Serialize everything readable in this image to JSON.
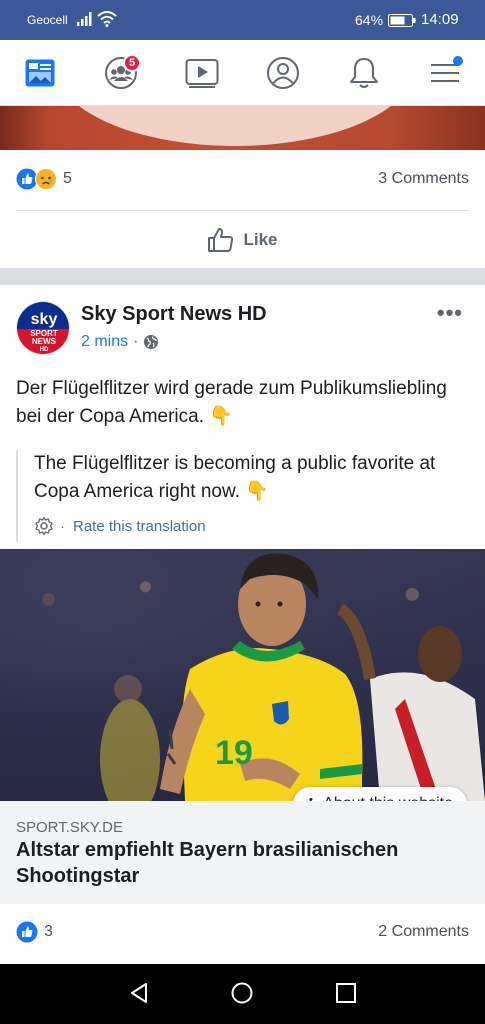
{
  "status_bar": {
    "carrier": "Geocell",
    "battery_percent": "64%",
    "time": "14:09"
  },
  "nav_bar": {
    "friends_badge": "5",
    "icons": [
      "news-feed-icon",
      "friends-icon",
      "watch-icon",
      "profile-icon",
      "notifications-icon",
      "menu-icon"
    ]
  },
  "previous_post": {
    "reaction_count": "5",
    "comments": "3 Comments",
    "like_label": "Like"
  },
  "post": {
    "page_name": "Sky Sport News HD",
    "avatar_text_top": "sky",
    "avatar_text_sport": "SPORT",
    "avatar_text_news": "NEWS",
    "avatar_text_hd": "HD",
    "time": "2 mins",
    "text": "Der Flügelflitzer wird gerade zum Publikumsliebling bei der Copa America. 👇",
    "translation": "The Flügelflitzer is becoming a public favorite at Copa America right now. 👇",
    "rate_translation": "Rate this translation",
    "about_website": "About this website",
    "link_domain": "SPORT.SKY.DE",
    "link_title": "Altstar empfiehlt Bayern brasilianischen Shootingstar",
    "reaction_count": "3",
    "comments": "2 Comments"
  },
  "colors": {
    "facebook_blue": "#3b5998",
    "link_blue": "#1877f2",
    "badge_red": "#e41e3f"
  }
}
